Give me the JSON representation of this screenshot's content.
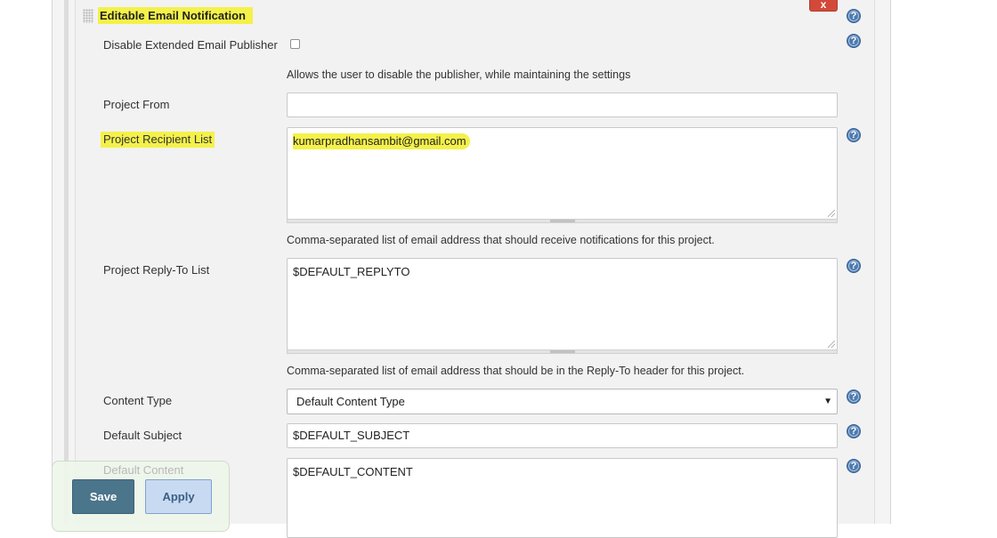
{
  "section": {
    "title": "Editable Email Notification",
    "delete_label": "x"
  },
  "disable_publisher": {
    "label": "Disable Extended Email Publisher",
    "checked": false,
    "description": "Allows the user to disable the publisher, while maintaining the settings"
  },
  "project_from": {
    "label": "Project From",
    "value": ""
  },
  "recipient_list": {
    "label": "Project Recipient List",
    "value": "kumarpradhansambit@gmail.com",
    "description": "Comma-separated list of email address that should receive notifications for this project."
  },
  "reply_to": {
    "label": "Project Reply-To List",
    "value": "$DEFAULT_REPLYTO",
    "description": "Comma-separated list of email address that should be in the Reply-To header for this project."
  },
  "content_type": {
    "label": "Content Type",
    "selected": "Default Content Type",
    "arrow": "▼"
  },
  "default_subject": {
    "label": "Default Subject",
    "value": "$DEFAULT_SUBJECT"
  },
  "default_content": {
    "label": "Default Content",
    "value": "$DEFAULT_CONTENT"
  },
  "buttons": {
    "save": "Save",
    "apply": "Apply"
  },
  "help_glyph": "?",
  "colors": {
    "highlight": "#f4f14a",
    "delete_button": "#d24939",
    "help_icon": "#4d7bb0",
    "save_button": "#4b758b",
    "apply_button": "#c8daf2"
  }
}
